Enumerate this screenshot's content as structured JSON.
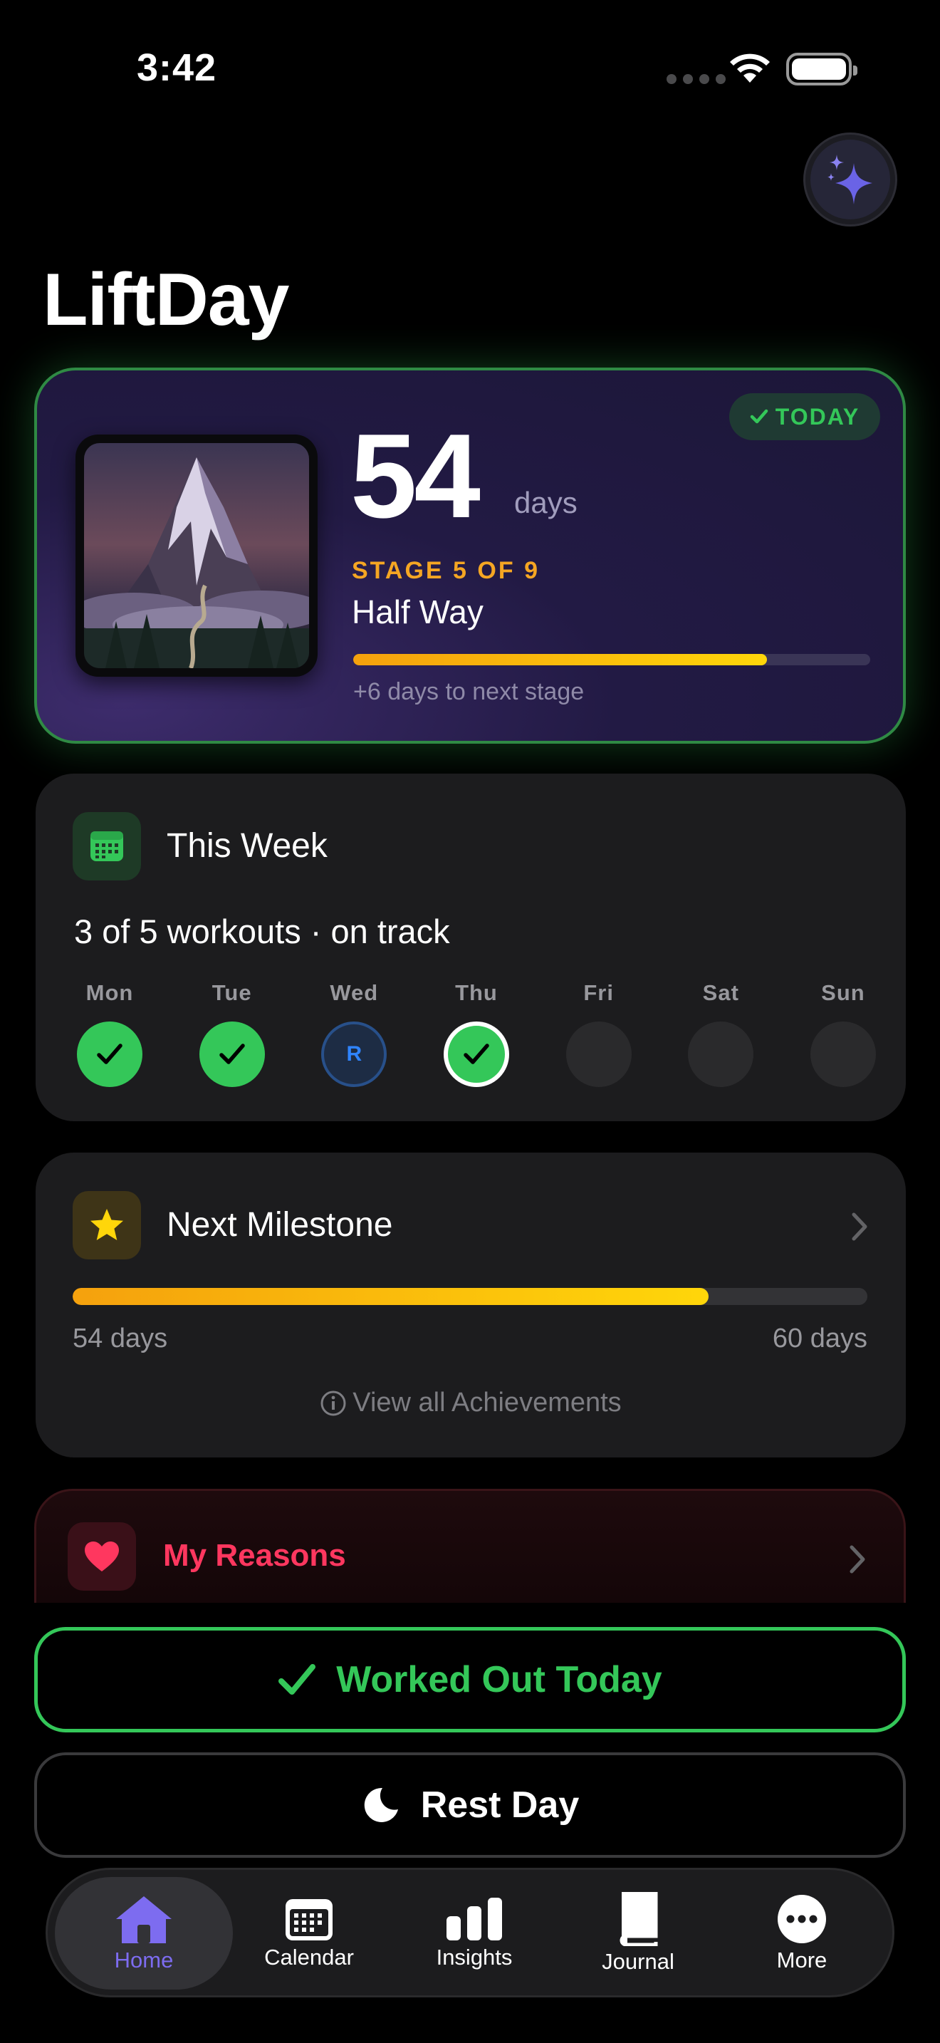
{
  "status_bar": {
    "time": "3:42"
  },
  "app": {
    "title": "LiftDay"
  },
  "hero": {
    "badge": "TODAY",
    "streak_days": "54",
    "streak_unit": "days",
    "stage_label": "STAGE 5 OF 9",
    "stage_name": "Half Way",
    "stage_progress": 0.8,
    "next_stage_text": "+6 days to next stage"
  },
  "week": {
    "title": "This Week",
    "summary": "3 of 5 workouts · on track",
    "days": [
      {
        "label": "Mon",
        "state": "done",
        "mark": ""
      },
      {
        "label": "Tue",
        "state": "done",
        "mark": ""
      },
      {
        "label": "Wed",
        "state": "rest",
        "mark": "R"
      },
      {
        "label": "Thu",
        "state": "done-today",
        "mark": ""
      },
      {
        "label": "Fri",
        "state": "empty",
        "mark": ""
      },
      {
        "label": "Sat",
        "state": "empty",
        "mark": ""
      },
      {
        "label": "Sun",
        "state": "empty",
        "mark": ""
      }
    ]
  },
  "milestone": {
    "title": "Next Milestone",
    "progress": 0.8,
    "current": "54 days",
    "target": "60 days",
    "link": "View all Achievements"
  },
  "reasons": {
    "title": "My Reasons"
  },
  "actions": {
    "worked_out": "Worked Out Today",
    "rest_day": "Rest Day"
  },
  "tabs": [
    {
      "label": "Home",
      "icon": "home-icon",
      "active": true
    },
    {
      "label": "Calendar",
      "icon": "calendar-icon",
      "active": false
    },
    {
      "label": "Insights",
      "icon": "bar-chart-icon",
      "active": false
    },
    {
      "label": "Journal",
      "icon": "book-icon",
      "active": false
    },
    {
      "label": "More",
      "icon": "more-icon",
      "active": false
    }
  ],
  "colors": {
    "accent_green": "#34c759",
    "accent_orange": "#f5a623",
    "accent_purple": "#7d6cf0",
    "reasons_red": "#ff375f"
  }
}
